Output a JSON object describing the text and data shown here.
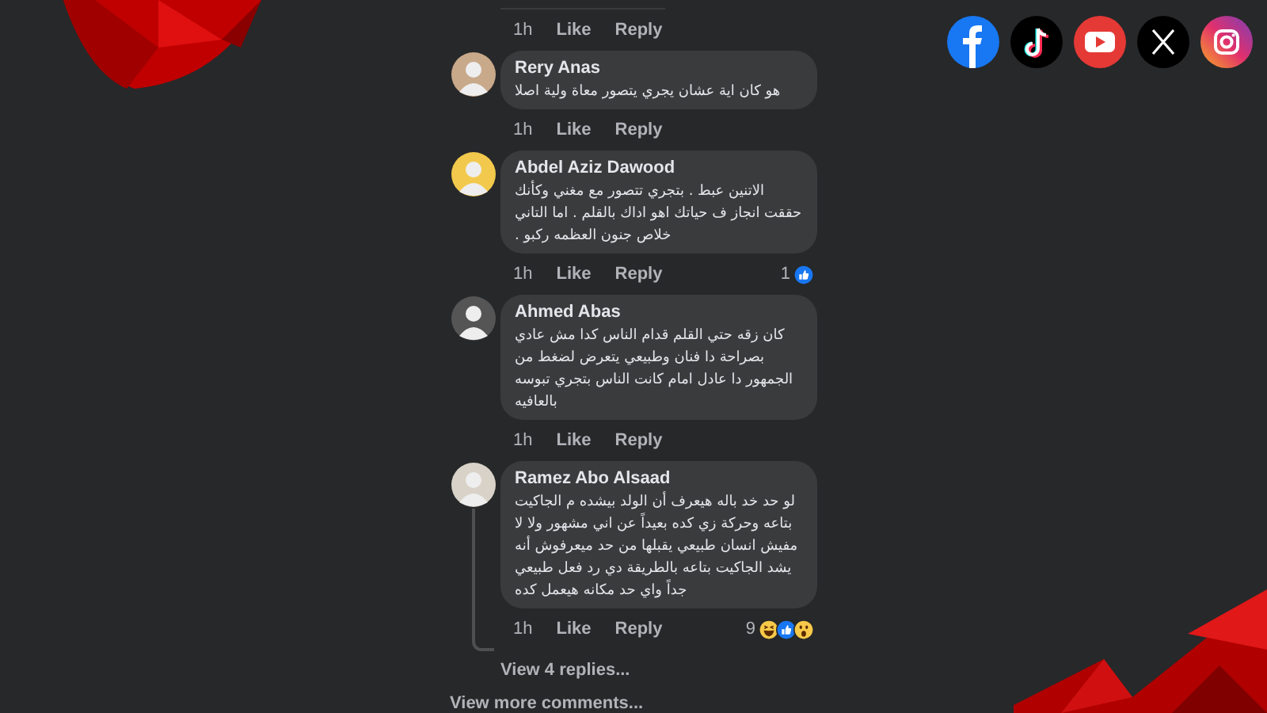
{
  "previous_comment": {
    "time": "1h",
    "like": "Like",
    "reply": "Reply"
  },
  "comments": [
    {
      "author": "Rery Anas",
      "text": "هو كان اية عشان يجري يتصور معاة ولية اصلا",
      "time": "1h",
      "like": "Like",
      "reply": "Reply"
    },
    {
      "author": "Abdel Aziz Dawood",
      "text": "الاتنين عبط . بتجري تتصور مع مغني وكأنك حققت انجاز ف حياتك اهو اداك بالقلم . اما التاني خلاص جنون العظمه ركبو .",
      "time": "1h",
      "like": "Like",
      "reply": "Reply",
      "reactions": {
        "count": "1",
        "icons": [
          {
            "kind": "like"
          }
        ]
      }
    },
    {
      "author": "Ahmed Abas",
      "text": "كان زقه حتي القلم قدام الناس كدا مش عادي بصراحة دا فنان وطبيعي يتعرض لضغط من الجمهور دا عادل امام كانت الناس بتجري تبوسه بالعافيه",
      "time": "1h",
      "like": "Like",
      "reply": "Reply"
    },
    {
      "author": "Ramez Abo Alsaad",
      "text": "لو حد خد باله هيعرف أن الولد بيشده م الجاكيت بتاعه وحركة زي كده بعيداً عن اني مشهور ولا لا مفيش انسان طبيعي يقبلها من حد ميعرفوش أنه يشد الجاكيت بتاعه بالطريقة دي رد فعل طبيعي جداً واي حد مكانه هيعمل كده",
      "time": "1h",
      "like": "Like",
      "reply": "Reply",
      "reactions": {
        "count": "9",
        "icons": [
          {
            "kind": "haha"
          },
          {
            "kind": "like"
          },
          {
            "kind": "wow"
          }
        ]
      },
      "view_replies": "View 4 replies..."
    }
  ],
  "view_more": "View more comments..."
}
